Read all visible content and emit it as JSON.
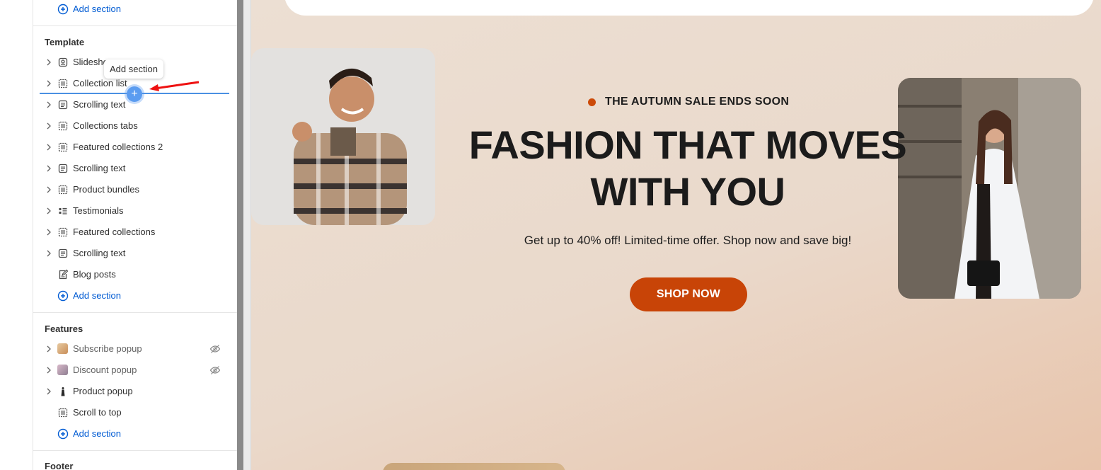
{
  "sidebar": {
    "top_add_section": "Add section",
    "template": {
      "title": "Template",
      "items": [
        {
          "label": "Slideshow",
          "icon": "slideshow-icon"
        },
        {
          "label": "Collection list",
          "icon": "layout-icon"
        },
        {
          "label": "Scrolling text",
          "icon": "text-block-icon"
        },
        {
          "label": "Collections tabs",
          "icon": "layout-icon"
        },
        {
          "label": "Featured collections 2",
          "icon": "layout-icon"
        },
        {
          "label": "Scrolling text",
          "icon": "text-block-icon"
        },
        {
          "label": "Product bundles",
          "icon": "layout-icon"
        },
        {
          "label": "Testimonials",
          "icon": "testimonials-icon"
        },
        {
          "label": "Featured collections",
          "icon": "layout-icon"
        },
        {
          "label": "Scrolling text",
          "icon": "text-block-icon"
        },
        {
          "label": "Blog posts",
          "icon": "blog-edit-icon"
        }
      ],
      "add_section": "Add section"
    },
    "features": {
      "title": "Features",
      "items": [
        {
          "label": "Subscribe popup",
          "hidden": true
        },
        {
          "label": "Discount popup",
          "hidden": true
        },
        {
          "label": "Product popup",
          "hidden": false
        },
        {
          "label": "Scroll to top",
          "hidden": false
        }
      ],
      "add_section": "Add section"
    },
    "footer": {
      "title": "Footer"
    },
    "drag_tooltip": "Add section"
  },
  "preview": {
    "badge": "THE AUTUMN SALE ENDS SOON",
    "headline_line1": "FASHION THAT MOVES",
    "headline_line2": "WITH YOU",
    "subtext": "Get up to 40% off! Limited-time offer. Shop now and save big!",
    "cta": "SHOP NOW"
  },
  "colors": {
    "accent": "#c84407",
    "link": "#005bd3",
    "drop_indicator": "#4a90e2"
  }
}
